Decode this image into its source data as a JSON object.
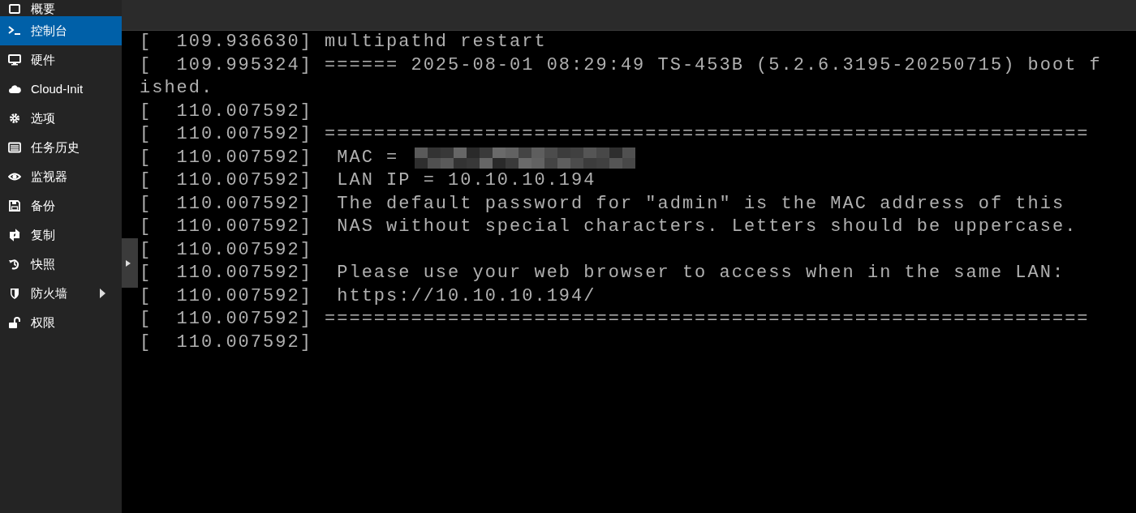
{
  "sidebar": {
    "items": [
      {
        "label": "概要",
        "selected": false,
        "expandable": false
      },
      {
        "label": "控制台",
        "selected": true,
        "expandable": false
      },
      {
        "label": "硬件",
        "selected": false,
        "expandable": false
      },
      {
        "label": "Cloud-Init",
        "selected": false,
        "expandable": false
      },
      {
        "label": "选项",
        "selected": false,
        "expandable": false
      },
      {
        "label": "任务历史",
        "selected": false,
        "expandable": false
      },
      {
        "label": "监视器",
        "selected": false,
        "expandable": false
      },
      {
        "label": "备份",
        "selected": false,
        "expandable": false
      },
      {
        "label": "复制",
        "selected": false,
        "expandable": false
      },
      {
        "label": "快照",
        "selected": false,
        "expandable": false
      },
      {
        "label": "防火墙",
        "selected": false,
        "expandable": true
      },
      {
        "label": "权限",
        "selected": false,
        "expandable": false
      }
    ]
  },
  "console": {
    "lines": [
      {
        "text": "[  109.936630] multipathd restart",
        "redacted": false
      },
      {
        "text": "[  109.995324] ====== 2025-08-01 08:29:49 TS-453B (5.2.6.3195-20250715) boot f",
        "redacted": false
      },
      {
        "text": "ished.",
        "redacted": false
      },
      {
        "text": "[  110.007592]",
        "redacted": false
      },
      {
        "text": "[  110.007592] ==============================================================",
        "redacted": false
      },
      {
        "text": "[  110.007592]  MAC =",
        "redacted": true
      },
      {
        "text": "[  110.007592]  LAN IP = 10.10.10.194",
        "redacted": false
      },
      {
        "text": "[  110.007592]  The default password for \"admin\" is the MAC address of this",
        "redacted": false
      },
      {
        "text": "[  110.007592]  NAS without special characters. Letters should be uppercase.",
        "redacted": false
      },
      {
        "text": "[  110.007592]",
        "redacted": false
      },
      {
        "text": "[  110.007592]  Please use your web browser to access when in the same LAN:",
        "redacted": false
      },
      {
        "text": "[  110.007592]  https://10.10.10.194/",
        "redacted": false
      },
      {
        "text": "[  110.007592] ==============================================================",
        "redacted": false
      },
      {
        "text": "[  110.007592]",
        "redacted": false
      }
    ]
  }
}
